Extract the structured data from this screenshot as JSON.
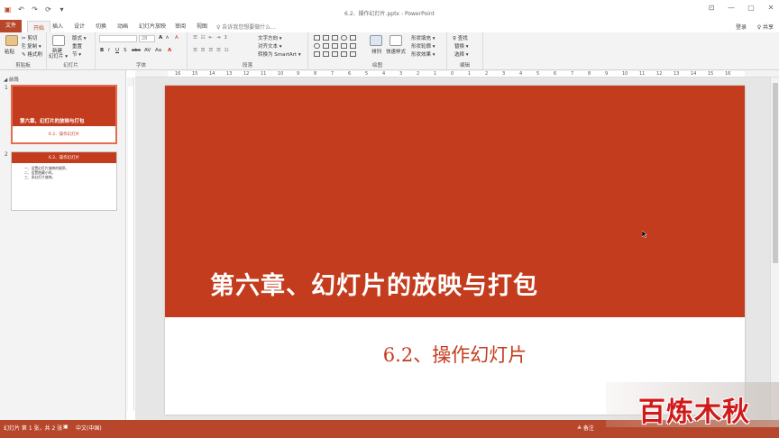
{
  "window": {
    "title": "6.2、操作幻灯片.pptx - PowerPoint",
    "minimize": "—",
    "restore": "▢",
    "close": "✕",
    "ribbon_display": "⊡"
  },
  "qat": {
    "save": "▣",
    "undo": "↶",
    "redo": "↷",
    "repeat": "⟳",
    "customize": "▾"
  },
  "tabs": [
    {
      "label": "文件"
    },
    {
      "label": "开始"
    },
    {
      "label": "插入"
    },
    {
      "label": "设计"
    },
    {
      "label": "切换"
    },
    {
      "label": "动画"
    },
    {
      "label": "幻灯片放映"
    },
    {
      "label": "审阅"
    },
    {
      "label": "视图"
    }
  ],
  "tell_me": "♀ 告诉我您想要做什么...",
  "user": "登录",
  "share": "♀ 共享",
  "ribbon": {
    "clipboard": {
      "label": "剪贴板",
      "paste": "粘贴",
      "cut": "✂ 剪切",
      "copy": "⎘ 复制 ▾",
      "format_painter": "✎ 格式刷"
    },
    "slides": {
      "label": "幻灯片",
      "new_slide": "新建",
      "new_slide2": "幻灯片 ▾",
      "layout": "版式 ▾",
      "reset": "重置",
      "section": "节 ▾"
    },
    "font": {
      "label": "字体",
      "font_size": "28",
      "bold": "B",
      "italic": "I",
      "underline": "U",
      "shadow": "S",
      "strike": "abc",
      "spacing": "AV",
      "case": "Aa",
      "color": "A",
      "grow": "A",
      "shrink": "A",
      "clear": "A"
    },
    "paragraph": {
      "label": "段落",
      "text_direction": "文字方向 ▾",
      "align_text": "对齐文本 ▾",
      "smartart": "转换为 SmartArt ▾"
    },
    "drawing": {
      "label": "绘图",
      "arrange": "排列",
      "quick_styles": "快速样式",
      "fill": "形状填充 ▾",
      "outline": "形状轮廓 ▾",
      "effects": "形状效果 ▾"
    },
    "editing": {
      "label": "编辑",
      "find": "♀ 查找",
      "replace": "替换 ▾",
      "select": "选择 ▾"
    }
  },
  "ruler": {
    "labels": [
      "16",
      "15",
      "14",
      "13",
      "12",
      "11",
      "10",
      "9",
      "8",
      "7",
      "6",
      "5",
      "4",
      "3",
      "2",
      "1",
      "0",
      "1",
      "2",
      "3",
      "4",
      "5",
      "6",
      "7",
      "8",
      "9",
      "10",
      "11",
      "12",
      "13",
      "14",
      "15",
      "16"
    ]
  },
  "left_pane": {
    "section": "◢ 前段",
    "thumbs": [
      {
        "num": "1",
        "title": "第六章、幻灯片的放映与打包",
        "sub": "6.2、操作幻灯片"
      },
      {
        "num": "2",
        "title": "6.2、操作幻灯片",
        "lines": [
          "一、设置幻灯片放映的顺序。",
          "二、设置隐藏小时。",
          "三、多幻灯片放映。"
        ]
      }
    ]
  },
  "slide": {
    "title": "第六章、幻灯片的放映与打包",
    "subtitle": "6.2、操作幻灯片"
  },
  "status": {
    "slide_info": "幻灯片 第 1 张，共 2 张",
    "language": "中文(中国)",
    "notes": "≜ 备注"
  },
  "watermark": "百炼木秋",
  "colors": {
    "accent": "#b7472a",
    "slide_red": "#c43c1e"
  }
}
